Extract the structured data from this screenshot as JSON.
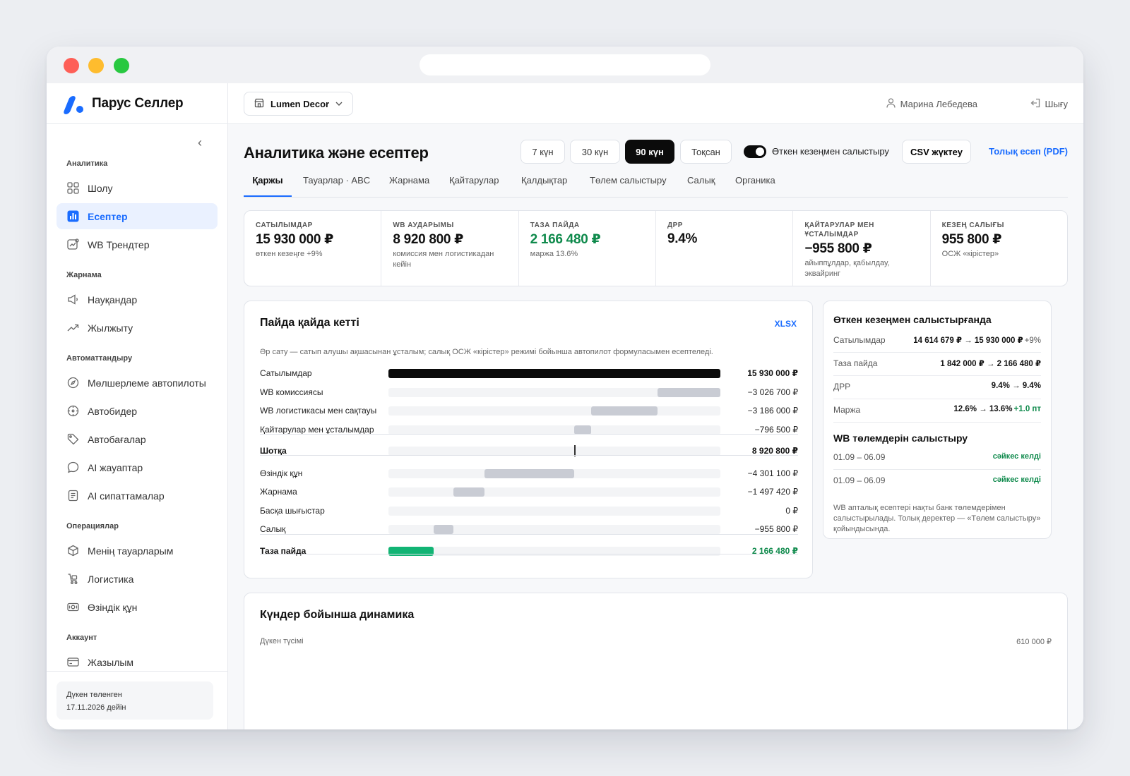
{
  "brand": {
    "name": "Парус Селлер"
  },
  "sidebar": {
    "sections": [
      {
        "title": "Аналитика",
        "items": [
          {
            "label": "Шолу",
            "icon": "grid-icon",
            "active": false
          },
          {
            "label": "Есептер",
            "icon": "chart-icon",
            "active": true
          },
          {
            "label": "WB Трендтер",
            "icon": "trend-card-icon",
            "active": false
          }
        ]
      },
      {
        "title": "Жарнама",
        "items": [
          {
            "label": "Науқандар",
            "icon": "megaphone-icon",
            "active": false
          },
          {
            "label": "Жылжыту",
            "icon": "trending-up-icon",
            "active": false
          }
        ]
      },
      {
        "title": "Автоматтандыру",
        "items": [
          {
            "label": "Мөлшерлеме автопилоты",
            "icon": "compass-icon",
            "active": false
          },
          {
            "label": "Автобидер",
            "icon": "target-icon",
            "active": false
          },
          {
            "label": "Автобағалар",
            "icon": "tag-icon",
            "active": false
          },
          {
            "label": "AI жауаптар",
            "icon": "chat-icon",
            "active": false
          },
          {
            "label": "AI сипаттамалар",
            "icon": "document-icon",
            "active": false
          }
        ]
      },
      {
        "title": "Операциялар",
        "items": [
          {
            "label": "Менің тауарларым",
            "icon": "box-icon",
            "active": false
          },
          {
            "label": "Логистика",
            "icon": "cart-icon",
            "active": false
          },
          {
            "label": "Өзіндік құн",
            "icon": "money-icon",
            "active": false
          }
        ]
      },
      {
        "title": "Аккаунт",
        "items": [
          {
            "label": "Жазылым",
            "icon": "card-icon",
            "active": false
          }
        ]
      }
    ],
    "paid": {
      "line1": "Дүкен төленген",
      "line2": "17.11.2026 дейін"
    }
  },
  "topbar": {
    "store": "Lumen Decor",
    "user": "Марина Лебедева",
    "logout": "Шығу"
  },
  "page": {
    "title": "Аналитика және есептер",
    "periods": [
      "7 күн",
      "30 күн",
      "90 күн",
      "Тоқсан"
    ],
    "active_period": "90 күн",
    "compare_toggle": "Өткен кезеңмен салыстыру",
    "compare_on": true,
    "csv": "CSV жүктеу",
    "pdf": "Толық есеп (PDF)"
  },
  "tabs": [
    "Қаржы",
    "Тауарлар · ABC",
    "Жарнама",
    "Қайтарулар",
    "Қалдықтар",
    "Төлем салыстыру",
    "Салық",
    "Органика"
  ],
  "kpis": [
    {
      "label": "САТЫЛЫМДАР",
      "value": "15 930 000 ₽",
      "sub": "өткен кезеңге +9%",
      "color": ""
    },
    {
      "label": "WB АУДАРЫМЫ",
      "value": "8 920 800 ₽",
      "sub": "комиссия мен логистикадан кейін",
      "color": ""
    },
    {
      "label": "ТАЗА ПАЙДА",
      "value": "2 166 480 ₽",
      "sub": "маржа 13.6%",
      "color": "green"
    },
    {
      "label": "ДРР",
      "value": "9.4%",
      "sub": "",
      "color": ""
    },
    {
      "label": "ҚАЙТАРУЛАР МЕН ҰСТАЛЫМДАР",
      "value": "−955 800 ₽",
      "sub": "айыппұлдар, қабылдау, эквайринг",
      "color": ""
    },
    {
      "label": "КЕЗЕҢ САЛЫҒЫ",
      "value": "955 800 ₽",
      "sub": "ОСЖ «кірістер»",
      "color": ""
    }
  ],
  "profit": {
    "title": "Пайда қайда кетті",
    "xlsx": "XLSX",
    "note": "Әр сату — сатып алушы ақшасынан ұсталым; салық ОСЖ «кірістер» режимі бойынша автопилот формуласымен есептеледі.",
    "rows": [
      {
        "label": "Сатылымдар",
        "value": "15 930 000 ₽",
        "amount": 15930000,
        "kind": "total"
      },
      {
        "label": "WB комиссиясы",
        "value": "−3 026 700 ₽",
        "amount": -3026700,
        "kind": "step"
      },
      {
        "label": "WB логистикасы мен сақтауы",
        "value": "−3 186 000 ₽",
        "amount": -3186000,
        "kind": "step"
      },
      {
        "label": "Қайтарулар мен ұсталымдар",
        "value": "−796 500 ₽",
        "amount": -796500,
        "kind": "step"
      },
      {
        "label": "Шотқа",
        "value": "8 920 800 ₽",
        "amount": 8920800,
        "kind": "subtotal"
      },
      {
        "label": "Өзіндік құн",
        "value": "−4 301 100 ₽",
        "amount": -4301100,
        "kind": "step"
      },
      {
        "label": "Жарнама",
        "value": "−1 497 420 ₽",
        "amount": -1497420,
        "kind": "step"
      },
      {
        "label": "Басқа шығыстар",
        "value": "0 ₽",
        "amount": 0,
        "kind": "step"
      },
      {
        "label": "Салық",
        "value": "−955 800 ₽",
        "amount": -955800,
        "kind": "step"
      },
      {
        "label": "Таза пайда",
        "value": "2 166 480 ₽",
        "amount": 2166480,
        "kind": "final"
      }
    ]
  },
  "compare": {
    "title": "Өткен кезеңмен салыстырғанда",
    "rows": [
      {
        "label": "Сатылымдар",
        "value": "14 614 679 ₽ → 15 930 000 ₽",
        "extra": "+9%",
        "extra_kind": "pct"
      },
      {
        "label": "Таза пайда",
        "value": "1 842 000 ₽ → 2 166 480 ₽",
        "extra": "",
        "extra_kind": ""
      },
      {
        "label": "ДРР",
        "value": "9.4% → 9.4%",
        "extra": "",
        "extra_kind": ""
      },
      {
        "label": "Маржа",
        "value": "12.6% → 13.6%",
        "extra": "+1.0 пт",
        "extra_kind": "delta"
      }
    ],
    "payments_title": "WB төлемдерін салыстыру",
    "payments": [
      {
        "period": "01.09 – 06.09",
        "status": "сәйкес келді"
      },
      {
        "period": "01.09 – 06.09",
        "status": "сәйкес келді"
      }
    ],
    "note": "WB апталық есептері нақты банк төлемдерімен салыстырылады. Толық деректер — «Төлем салыстыру» қойындысында."
  },
  "dynamics": {
    "title": "Күндер бойынша динамика",
    "series_label": "Дүкен түсімі",
    "max_label": "610 000 ₽"
  },
  "chart_data": {
    "type": "bar",
    "title": "Күндер бойынша динамика",
    "ylabel": "Дүкен түсімі",
    "ymax": 610000,
    "color": "#4f8ff7",
    "values": [
      0,
      0,
      0,
      0,
      0,
      0,
      0,
      0,
      0,
      0,
      0,
      0,
      0,
      0,
      0,
      0,
      0,
      0,
      0,
      0,
      0,
      0,
      0,
      0,
      0,
      0,
      0,
      0,
      0,
      0,
      0,
      0,
      0,
      0,
      0,
      0,
      0,
      0,
      0,
      0,
      0,
      0,
      0,
      0,
      0,
      0,
      0,
      0,
      0,
      0,
      0,
      0,
      0,
      0,
      0,
      0,
      0,
      0,
      0,
      0,
      0,
      0,
      0,
      0,
      0,
      0,
      0,
      0,
      0,
      0,
      0,
      0,
      0,
      0,
      0,
      0,
      0,
      0,
      0,
      0,
      0,
      0,
      0,
      0,
      0,
      0,
      0,
      0,
      0,
      0
    ]
  },
  "colors": {
    "accent": "#1a6cff",
    "positive": "#0f8a4c",
    "bar_grey": "#c9ccd4",
    "bar_green": "#12b474",
    "chart_blue": "#4f8ff7"
  }
}
